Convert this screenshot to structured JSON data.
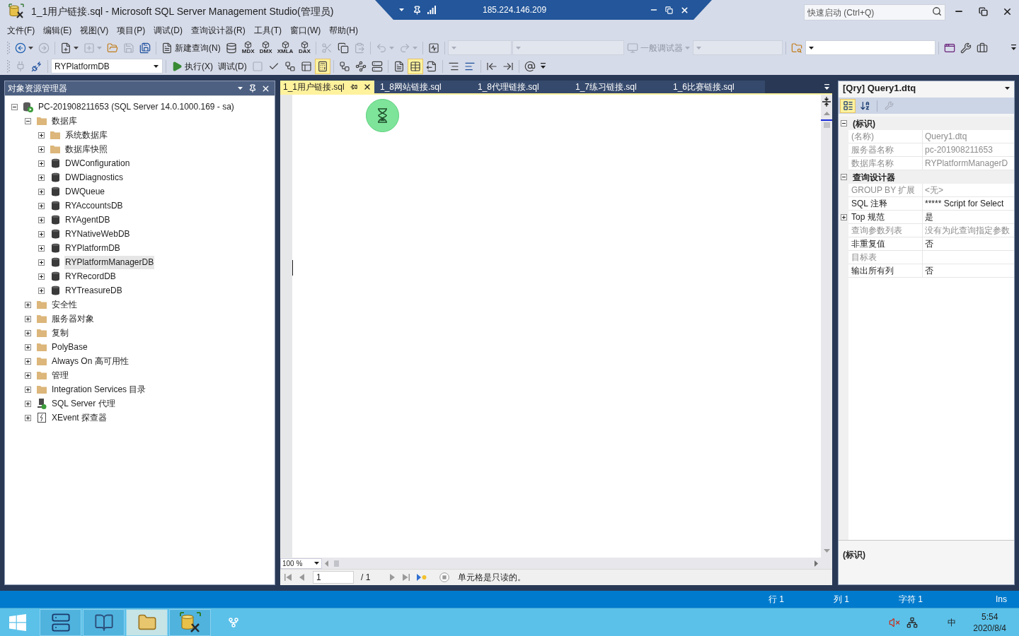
{
  "title_bar": {
    "title": "1_1用户链接.sql - Microsoft SQL Server Management Studio(管理员)",
    "quick_launch": {
      "placeholder": "快速启动 (Ctrl+Q)"
    }
  },
  "remote_bar": {
    "address": "185.224.146.209"
  },
  "menu": [
    "文件(F)",
    "编辑(E)",
    "视图(V)",
    "项目(P)",
    "调试(D)",
    "查询设计器(R)",
    "工具(T)",
    "窗口(W)",
    "帮助(H)"
  ],
  "toolbar_1": [
    [
      {
        "kind": "back",
        "disabled": false
      },
      {
        "kind": "forward",
        "disabled": true
      }
    ],
    [
      {
        "kind": "newproject",
        "disabled": false
      },
      {
        "kind": "additem",
        "disabled": true
      },
      {
        "kind": "open",
        "disabled": false
      },
      {
        "kind": "save",
        "disabled": true
      },
      {
        "kind": "saveall",
        "disabled": false
      }
    ],
    [
      {
        "kind": "newquery",
        "label": "新建查询(N)",
        "disabled": false
      },
      {
        "kind": "dbquery",
        "disabled": false
      },
      {
        "kind": "cube",
        "label": "MDX",
        "disabled": false
      },
      {
        "kind": "cube",
        "label": "DMX",
        "disabled": false
      },
      {
        "kind": "cube",
        "label": "XMLA",
        "disabled": false
      },
      {
        "kind": "cube",
        "label": "DAX",
        "disabled": false
      }
    ],
    [
      {
        "kind": "cut",
        "disabled": true
      },
      {
        "kind": "copy",
        "disabled": false
      },
      {
        "kind": "paste",
        "disabled": true
      }
    ],
    [
      {
        "kind": "undo",
        "disabled": true
      },
      {
        "kind": "redo",
        "disabled": true
      }
    ],
    [
      {
        "kind": "activity",
        "disabled": false
      }
    ],
    [
      {
        "kind": "configcombo",
        "disabled": true
      },
      {
        "kind": "platformcombo",
        "disabled": true
      },
      {
        "kind": "debugger",
        "label": "一般调试器",
        "disabled": true
      },
      {
        "kind": "targetcombo",
        "disabled": true
      }
    ],
    [
      {
        "kind": "find",
        "disabled": false
      },
      {
        "kind": "searchcombo",
        "disabled": false
      }
    ],
    [
      {
        "kind": "vsmenu",
        "disabled": false
      },
      {
        "kind": "settings",
        "disabled": false
      },
      {
        "kind": "toolbox",
        "disabled": false
      }
    ]
  ],
  "toolbar_2": [
    [
      {
        "kind": "connect",
        "disabled": true,
        "pressed": false
      },
      {
        "kind": "changeconnection",
        "disabled": false,
        "pressed": false
      }
    ],
    [
      {
        "kind": "dbcombo",
        "value": "RYPlatformDB",
        "disabled": false,
        "pressed": false
      }
    ],
    [
      {
        "kind": "execute",
        "label": "执行(X)",
        "disabled": false,
        "pressed": false
      },
      {
        "kind": "debug",
        "label": "调试(D)",
        "disabled": false,
        "pressed": false
      },
      {
        "kind": "stop",
        "disabled": true,
        "pressed": false
      },
      {
        "kind": "parse",
        "disabled": false,
        "pressed": false
      },
      {
        "kind": "estimatedplan",
        "disabled": false,
        "pressed": false
      },
      {
        "kind": "queryoptions",
        "disabled": false,
        "pressed": false
      },
      {
        "kind": "intellisense",
        "disabled": false,
        "pressed": true
      }
    ],
    [
      {
        "kind": "actualplan",
        "disabled": false,
        "pressed": false
      },
      {
        "kind": "livestats",
        "disabled": false,
        "pressed": false
      },
      {
        "kind": "clientstats",
        "disabled": false,
        "pressed": false
      }
    ],
    [
      {
        "kind": "totext",
        "disabled": false,
        "pressed": false
      },
      {
        "kind": "togrid",
        "disabled": false,
        "pressed": true
      },
      {
        "kind": "tofile",
        "disabled": false,
        "pressed": false
      }
    ],
    [
      {
        "kind": "comment",
        "disabled": false,
        "pressed": false
      },
      {
        "kind": "uncomment",
        "disabled": false,
        "pressed": false
      }
    ],
    [
      {
        "kind": "outdent",
        "disabled": false,
        "pressed": false
      },
      {
        "kind": "indent",
        "disabled": false,
        "pressed": false
      }
    ],
    [
      {
        "kind": "templateparams",
        "disabled": false,
        "pressed": false
      }
    ]
  ],
  "object_explorer": {
    "title": "对象资源管理器",
    "tree": [
      {
        "label": "PC-201908211653 (SQL Server 14.0.1000.169 - sa)",
        "kind": "server",
        "expanded": true,
        "selected": false,
        "children": [
          {
            "label": "数据库",
            "kind": "folder",
            "expanded": true,
            "selected": false,
            "children": [
              {
                "label": "系统数据库",
                "kind": "folder",
                "expanded": false,
                "selected": false
              },
              {
                "label": "数据库快照",
                "kind": "folder",
                "expanded": false,
                "selected": false
              },
              {
                "label": "DWConfiguration",
                "kind": "database",
                "expanded": false,
                "selected": false
              },
              {
                "label": "DWDiagnostics",
                "kind": "database",
                "expanded": false,
                "selected": false
              },
              {
                "label": "DWQueue",
                "kind": "database",
                "expanded": false,
                "selected": false
              },
              {
                "label": "RYAccountsDB",
                "kind": "database",
                "expanded": false,
                "selected": false
              },
              {
                "label": "RYAgentDB",
                "kind": "database",
                "expanded": false,
                "selected": false
              },
              {
                "label": "RYNativeWebDB",
                "kind": "database",
                "expanded": false,
                "selected": false
              },
              {
                "label": "RYPlatformDB",
                "kind": "database",
                "expanded": false,
                "selected": false
              },
              {
                "label": "RYPlatformManagerDB",
                "kind": "database",
                "expanded": false,
                "selected": true
              },
              {
                "label": "RYRecordDB",
                "kind": "database",
                "expanded": false,
                "selected": false
              },
              {
                "label": "RYTreasureDB",
                "kind": "database",
                "expanded": false,
                "selected": false
              }
            ]
          },
          {
            "label": "安全性",
            "kind": "folder",
            "expanded": false,
            "selected": false
          },
          {
            "label": "服务器对象",
            "kind": "folder",
            "expanded": false,
            "selected": false
          },
          {
            "label": "复制",
            "kind": "folder",
            "expanded": false,
            "selected": false
          },
          {
            "label": "PolyBase",
            "kind": "folder",
            "expanded": false,
            "selected": false
          },
          {
            "label": "Always On 高可用性",
            "kind": "folder",
            "expanded": false,
            "selected": false
          },
          {
            "label": "管理",
            "kind": "folder",
            "expanded": false,
            "selected": false
          },
          {
            "label": "Integration Services 目录",
            "kind": "folder",
            "expanded": false,
            "selected": false
          },
          {
            "label": "SQL Server 代理",
            "kind": "agent",
            "expanded": false,
            "selected": false
          },
          {
            "label": "XEvent 探查器",
            "kind": "xevent",
            "expanded": false,
            "selected": false
          }
        ]
      }
    ]
  },
  "editor": {
    "tabs": [
      {
        "label": "1_1用户链接.sql",
        "selected": true
      },
      {
        "label": "1_8网站链接.sql",
        "selected": false
      },
      {
        "label": "1_8代理链接.sql",
        "selected": false
      },
      {
        "label": "1_7练习链接.sql",
        "selected": false
      },
      {
        "label": "1_6比赛链接.sql",
        "selected": false
      }
    ],
    "zoom": "100 %",
    "navigator": {
      "current": "1",
      "total": "/ 1",
      "message": "单元格是只读的。"
    }
  },
  "properties": {
    "object": "[Qry] Query1.dtq",
    "view_buttons": [
      {
        "kind": "categorized",
        "selected": true
      },
      {
        "kind": "alphabetical",
        "selected": false
      }
    ],
    "pages_button": {
      "disabled": true
    },
    "categories": [
      {
        "label": "(标识)",
        "expanded": true,
        "items": [
          {
            "name": "(名称)",
            "value": "Query1.dtq",
            "readonly": true,
            "kind": "value"
          },
          {
            "name": "服务器名称",
            "value": "pc-201908211653",
            "readonly": true,
            "kind": "value"
          },
          {
            "name": "数据库名称",
            "value": "RYPlatformManagerD",
            "readonly": true,
            "kind": "value"
          }
        ]
      },
      {
        "label": "查询设计器",
        "expanded": true,
        "items": [
          {
            "name": "GROUP BY 扩展",
            "value": "<无>",
            "readonly": true,
            "kind": "value"
          },
          {
            "name": "SQL 注释",
            "value": "***** Script for Select",
            "readonly": false,
            "kind": "value"
          },
          {
            "name": "Top 规范",
            "value": "是",
            "readonly": false,
            "kind": "group",
            "expanded": false
          },
          {
            "name": "查询参数列表",
            "value": "没有为此查询指定参数",
            "readonly": true,
            "kind": "value"
          },
          {
            "name": "非重复值",
            "value": "否",
            "readonly": false,
            "kind": "value"
          },
          {
            "name": "目标表",
            "readonly": true,
            "kind": "value"
          },
          {
            "name": "输出所有列",
            "value": "否",
            "readonly": false,
            "kind": "value"
          }
        ]
      }
    ],
    "description": "(标识)"
  },
  "status_bar": [
    "行 1",
    "列 1",
    "字符 1",
    "Ins"
  ],
  "taskbar": {
    "items": [
      {
        "kind": "server",
        "running": true,
        "active": false
      },
      {
        "kind": "notebook",
        "running": true,
        "active": false
      },
      {
        "kind": "folder",
        "running": true,
        "active": true
      },
      {
        "kind": "database",
        "running": true,
        "active": false
      },
      {
        "kind": "fork",
        "running": false,
        "active": false
      }
    ],
    "tray": {
      "ime": "中",
      "time": "5:54",
      "date": "2020/8/4"
    }
  }
}
